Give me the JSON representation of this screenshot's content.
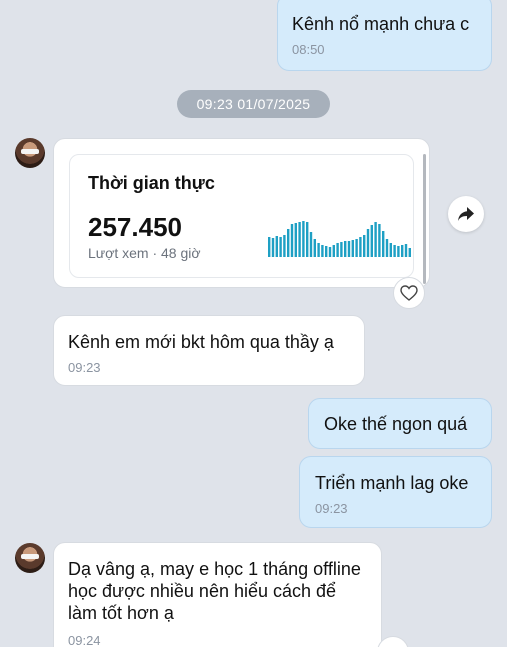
{
  "messages": [
    {
      "text": "Kênh nổ mạnh chưa c",
      "time": "08:50"
    },
    {
      "text": "Kênh em mới bkt hôm qua thầy ạ",
      "time": "09:23"
    },
    {
      "text": "Oke thế ngon quá"
    },
    {
      "text": "Triển mạnh lag oke",
      "time": "09:23"
    },
    {
      "text": "Dạ vâng ạ, may e học 1 tháng offline học được nhiều nên hiểu cách để làm tốt hơn ạ",
      "time": "09:24"
    }
  ],
  "date_separator": "09:23 01/07/2025",
  "stats_card": {
    "title": "Thời gian thực",
    "value": "257.450",
    "subtitle": "Lượt xem · 48 giờ"
  },
  "icons": {
    "share": "share-icon",
    "heart": "heart-icon",
    "avatar": "avatar"
  },
  "colors": {
    "sparkline": "#1ea0c4",
    "mine_bubble": "#d5ebfb",
    "theirs_bubble": "#ffffff",
    "background": "#dfe3ea"
  }
}
